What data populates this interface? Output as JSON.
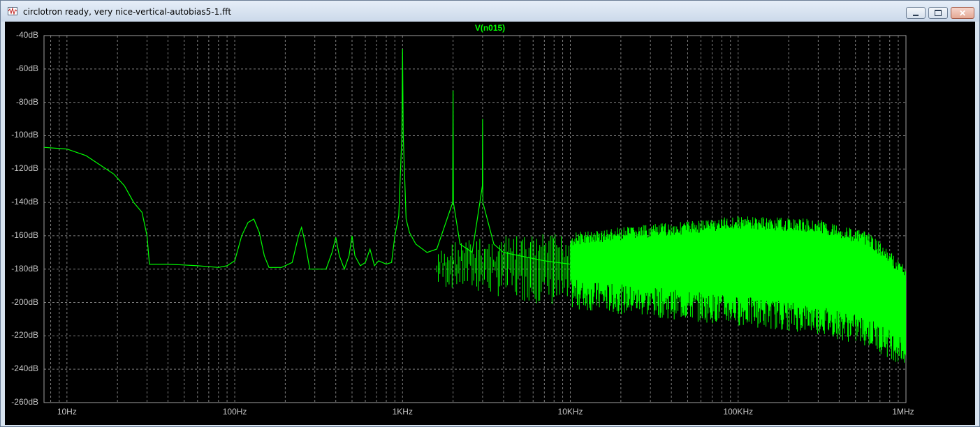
{
  "window": {
    "title": "circlotron ready, very nice-vertical-autobias5-1.fft",
    "app_icon": "waveform-icon",
    "buttons": {
      "minimize": "minimize-icon",
      "maximize": "maximize-icon",
      "close": "close-icon"
    }
  },
  "colors": {
    "background": "#000000",
    "trace": "#00ff00",
    "grid": "#808080",
    "axis_text": "#c8c8c8"
  },
  "chart_data": {
    "type": "line",
    "title": "V(n015)",
    "xscale": "log",
    "xlim": [
      7.3,
      1000000
    ],
    "ylim": [
      -260,
      -40
    ],
    "grid": true,
    "x_ticks": [
      {
        "value": 10,
        "label": "10Hz"
      },
      {
        "value": 100,
        "label": "100Hz"
      },
      {
        "value": 1000,
        "label": "1KHz"
      },
      {
        "value": 10000,
        "label": "10KHz"
      },
      {
        "value": 100000,
        "label": "100KHz"
      },
      {
        "value": 1000000,
        "label": "1MHz"
      }
    ],
    "y_ticks": [
      {
        "value": -40,
        "label": "-40dB"
      },
      {
        "value": -60,
        "label": "-60dB"
      },
      {
        "value": -80,
        "label": "-80dB"
      },
      {
        "value": -100,
        "label": "-100dB"
      },
      {
        "value": -120,
        "label": "-120dB"
      },
      {
        "value": -140,
        "label": "-140dB"
      },
      {
        "value": -160,
        "label": "-160dB"
      },
      {
        "value": -180,
        "label": "-180dB"
      },
      {
        "value": -200,
        "label": "-200dB"
      },
      {
        "value": -220,
        "label": "-220dB"
      },
      {
        "value": -240,
        "label": "-240dB"
      },
      {
        "value": -260,
        "label": "-260dB"
      }
    ],
    "series": [
      {
        "name": "V(n015)",
        "color": "#00ff00",
        "points": [
          [
            7.3,
            -107
          ],
          [
            10,
            -108
          ],
          [
            13,
            -112
          ],
          [
            16,
            -118
          ],
          [
            19,
            -123
          ],
          [
            22,
            -130
          ],
          [
            25,
            -140
          ],
          [
            28,
            -146
          ],
          [
            30,
            -160
          ],
          [
            31,
            -177
          ],
          [
            40,
            -177
          ],
          [
            60,
            -178
          ],
          [
            80,
            -179
          ],
          [
            90,
            -178
          ],
          [
            100,
            -175
          ],
          [
            110,
            -160
          ],
          [
            120,
            -152
          ],
          [
            130,
            -150
          ],
          [
            140,
            -158
          ],
          [
            150,
            -172
          ],
          [
            160,
            -179
          ],
          [
            190,
            -179
          ],
          [
            220,
            -176
          ],
          [
            240,
            -160
          ],
          [
            250,
            -155
          ],
          [
            260,
            -162
          ],
          [
            280,
            -180
          ],
          [
            300,
            -180
          ],
          [
            350,
            -180
          ],
          [
            380,
            -170
          ],
          [
            400,
            -161
          ],
          [
            420,
            -172
          ],
          [
            450,
            -180
          ],
          [
            480,
            -172
          ],
          [
            500,
            -160
          ],
          [
            520,
            -172
          ],
          [
            560,
            -178
          ],
          [
            600,
            -176
          ],
          [
            640,
            -168
          ],
          [
            680,
            -178
          ],
          [
            720,
            -175
          ],
          [
            800,
            -177
          ],
          [
            860,
            -176
          ],
          [
            900,
            -160
          ],
          [
            950,
            -148
          ],
          [
            990,
            -100
          ],
          [
            1000,
            -48
          ],
          [
            1010,
            -100
          ],
          [
            1050,
            -150
          ],
          [
            1100,
            -158
          ],
          [
            1200,
            -165
          ],
          [
            1400,
            -170
          ],
          [
            1600,
            -168
          ],
          [
            1990,
            -140
          ],
          [
            2000,
            -73
          ],
          [
            2010,
            -140
          ],
          [
            2200,
            -165
          ],
          [
            2600,
            -170
          ],
          [
            2990,
            -130
          ],
          [
            3000,
            -90
          ],
          [
            3010,
            -140
          ],
          [
            3500,
            -165
          ],
          [
            4000,
            -170
          ],
          [
            5000,
            -172
          ],
          [
            7000,
            -175
          ],
          [
            10000,
            -177
          ],
          [
            20000,
            -176
          ],
          [
            40000,
            -176
          ],
          [
            70000,
            -175
          ],
          [
            100000,
            -175
          ],
          [
            200000,
            -175
          ],
          [
            400000,
            -177
          ],
          [
            700000,
            -182
          ],
          [
            1000000,
            -187
          ]
        ]
      }
    ],
    "noise_band": {
      "x_start": 1600,
      "x_full": 10000,
      "upper": [
        [
          2000,
          -162
        ],
        [
          10000,
          -158
        ],
        [
          100000,
          -148
        ],
        [
          300000,
          -150
        ],
        [
          600000,
          -158
        ],
        [
          1000000,
          -178
        ]
      ],
      "lower": [
        [
          2000,
          -183
        ],
        [
          10000,
          -195
        ],
        [
          100000,
          -205
        ],
        [
          300000,
          -210
        ],
        [
          600000,
          -218
        ],
        [
          1000000,
          -230
        ]
      ]
    }
  }
}
